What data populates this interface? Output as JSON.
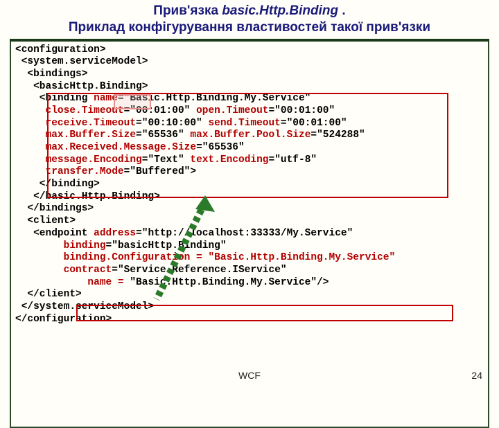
{
  "title": {
    "line1_pre": "Прив'язка ",
    "line1_em": "basic.Http.Binding",
    "line1_post": " .",
    "line2": "Приклад конфігурування властивостей такої прив'язки"
  },
  "code": {
    "l01": "<configuration>",
    "l02": " <system.serviceModel>",
    "l03": "  <bindings>",
    "l04": "   <basicHttp.Binding>",
    "l05a": "    <binding ",
    "l05b": "name",
    "l05c": "=\"Basic.Http.Binding.My.Service\"",
    "l06a": "     ",
    "l06b": "close.Timeout",
    "l06c": "=\"00:01:00\" ",
    "l06d": "open.Timeout",
    "l06e": "=\"00:01:00\"",
    "l07a": "     ",
    "l07b": "receive.Timeout",
    "l07c": "=\"00:10:00\" ",
    "l07d": "send.Timeout",
    "l07e": "=\"00:01:00\"",
    "l08a": "     ",
    "l08b": "max.Buffer.Size",
    "l08c": "=\"65536\" ",
    "l08d": "max.Buffer.Pool.Size",
    "l08e": "=\"524288\"",
    "l09a": "     ",
    "l09b": "max.Received.Message.Size",
    "l09c": "=\"65536\"",
    "l10a": "     ",
    "l10b": "message.Encoding",
    "l10c": "=\"Text\" ",
    "l10d": "text.Encoding",
    "l10e": "=\"utf-8\"",
    "l11a": "     ",
    "l11b": "transfer.Mode",
    "l11c": "=\"Buffered\">",
    "l12": "    </binding>",
    "l13": "   </basic.Http.Binding>",
    "l14": "  </bindings>",
    "l15": "  <client>",
    "l16a": "   <endpoint ",
    "l16b": "address",
    "l16c": "=\"http://localhost:33333/My.Service\"",
    "l17a": "        ",
    "l17b": "binding",
    "l17c": "=\"basicHttp.Binding\"",
    "l18a": "        ",
    "l18b": "binding.Configuration = \"Basic.Http.Binding.My.Service\"",
    "l19a": "        ",
    "l19b": "contract",
    "l19c": "=\"Service.Reference.IService\"",
    "l20a": "            ",
    "l20b": "name = ",
    "l20c": "\"Basic.Http.Binding.My.Service\"/>",
    "l21": "  </client>",
    "l22": " </system.serviceModel>",
    "l23": "</configuration>"
  },
  "footer": {
    "center": "WCF",
    "right": "24"
  }
}
